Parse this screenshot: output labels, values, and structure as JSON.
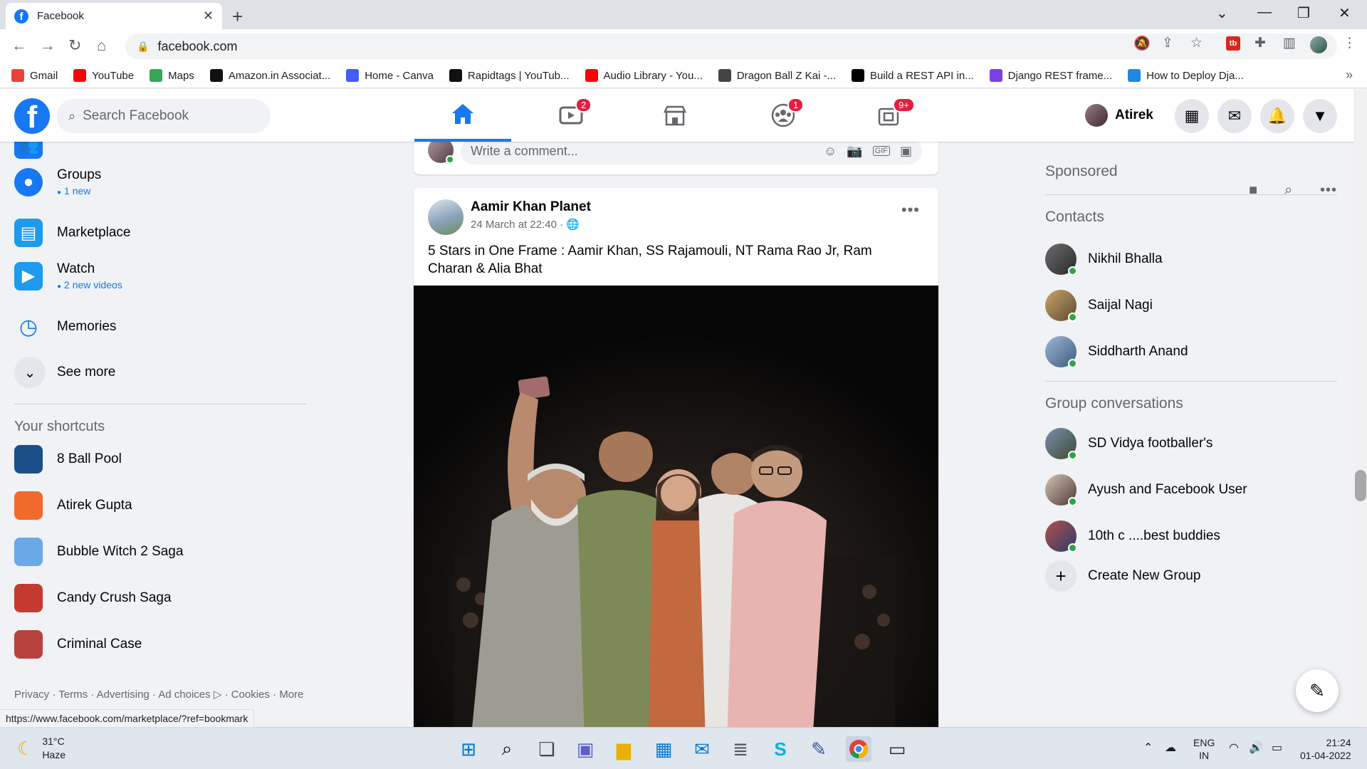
{
  "browser": {
    "tab_title": "Facebook",
    "url": "facebook.com",
    "bookmarks": [
      {
        "label": "Gmail",
        "icon": "gmail-icon",
        "color": "#ea4335"
      },
      {
        "label": "YouTube",
        "icon": "youtube-icon",
        "color": "#ff0000"
      },
      {
        "label": "Maps",
        "icon": "maps-icon",
        "color": "#34a853"
      },
      {
        "label": "Amazon.in Associat...",
        "icon": "amazon-icon",
        "color": "#111111"
      },
      {
        "label": "Home - Canva",
        "icon": "canva-icon",
        "color": "#3f5efb"
      },
      {
        "label": "Rapidtags | YouTub...",
        "icon": "rapidtags-icon",
        "color": "#111111"
      },
      {
        "label": "Audio Library - You...",
        "icon": "youtube-icon",
        "color": "#ff0000"
      },
      {
        "label": "Dragon Ball Z Kai -...",
        "icon": "dragonball-icon",
        "color": "#444444"
      },
      {
        "label": "Build a REST API in...",
        "icon": "medium-icon",
        "color": "#000000"
      },
      {
        "label": "Django REST frame...",
        "icon": "django-icon",
        "color": "#7b3fe4"
      },
      {
        "label": "How to Deploy Dja...",
        "icon": "s-icon",
        "color": "#1e88e5"
      }
    ],
    "status_url": "https://www.facebook.com/marketplace/?ref=bookmark"
  },
  "header": {
    "search_placeholder": "Search Facebook",
    "watch_badge": "2",
    "groups_badge": "1",
    "gaming_badge": "9+",
    "profile_name": "Atirek"
  },
  "left": {
    "items": [
      {
        "label": "Groups",
        "sub": "1 new"
      },
      {
        "label": "Marketplace",
        "sub": ""
      },
      {
        "label": "Watch",
        "sub": "2 new videos"
      },
      {
        "label": "Memories",
        "sub": ""
      }
    ],
    "see_more": "See more",
    "shortcuts_title": "Your shortcuts",
    "shortcuts": [
      "8 Ball Pool",
      "Atirek Gupta",
      "Bubble Witch 2 Saga",
      "Candy Crush Saga",
      "Criminal Case"
    ],
    "footer": "Privacy · Terms · Advertising · Ad choices ▷ · Cookies · More"
  },
  "feed": {
    "comment_placeholder": "Write a comment...",
    "post": {
      "author": "Aamir Khan Planet",
      "meta": "24 March at 22:40 ·",
      "text": "5 Stars in One Frame : Aamir Khan, SS Rajamouli, NT Rama Rao Jr, Ram Charan & Alia Bhat"
    }
  },
  "right": {
    "sponsored": "Sponsored",
    "contacts_title": "Contacts",
    "contacts": [
      "Nikhil Bhalla",
      "Saijal Nagi",
      "Siddharth Anand"
    ],
    "group_title": "Group conversations",
    "groups": [
      "SD Vidya footballer's",
      "Ayush and Facebook User",
      "10th c ....best buddies"
    ],
    "create_group": "Create New Group"
  },
  "taskbar": {
    "temp": "31°C",
    "weather": "Haze",
    "lang1": "ENG",
    "lang2": "IN",
    "time": "21:24",
    "date": "01-04-2022"
  }
}
